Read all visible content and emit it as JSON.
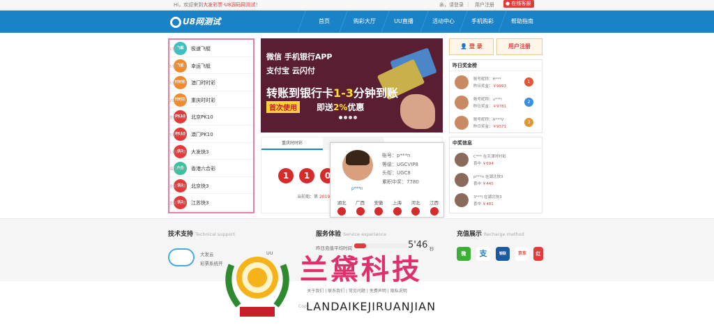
{
  "topbar": {
    "greeting": "Hi，欢迎来到",
    "brand": "大发彩票-U8源码网测试",
    "greeting_end": "！",
    "login": "亲，请登录",
    "sep": "|",
    "register": "用户注册",
    "service": "在线客服"
  },
  "logo": "U8网测试",
  "nav": [
    "首页",
    "购彩大厅",
    "UU直播",
    "活动中心",
    "手机购彩",
    "帮助指南"
  ],
  "lotteries": [
    {
      "name": "极速飞艇",
      "desc": "1分钟",
      "color": "#3cc0c0",
      "icon": "飞艇"
    },
    {
      "name": "幸运飞艇",
      "desc": "5分钟1期",
      "color": "#f08a2a",
      "icon": "飞艇"
    },
    {
      "name": "澳门时时彩",
      "desc": "5分钟一期",
      "color": "#f08a2a",
      "icon": "时时彩"
    },
    {
      "name": "重庆时时彩",
      "desc": "20分一期",
      "color": "#f08a2a",
      "icon": "时时彩"
    },
    {
      "name": "北京PK10",
      "desc": "全天44期",
      "color": "#e23a3a",
      "icon": "PK10"
    },
    {
      "name": "澳门PK10",
      "desc": "5分钟1期",
      "color": "#e23a3a",
      "icon": "PK10"
    },
    {
      "name": "大发快3",
      "desc": "1分钟1期",
      "color": "#e23a3a",
      "icon": "快3"
    },
    {
      "name": "香港六合彩",
      "desc": "每周三期",
      "color": "#3cc0a0",
      "icon": "六合"
    },
    {
      "name": "北京快3",
      "desc": "全天44期",
      "color": "#e23a3a",
      "icon": "快3"
    },
    {
      "name": "江苏快3",
      "desc": "全天41期",
      "color": "#e23a3a",
      "icon": "快3"
    }
  ],
  "banner": {
    "line1": "微信  手机银行APP",
    "line2": "支付宝  云闪付",
    "line3a": "转账到银行卡",
    "line3b": "1-3",
    "line3c": "分钟到账",
    "badge": "首次使用",
    "line4a": "即送",
    "line4b": "2%",
    "line4c": "优惠"
  },
  "draw": {
    "tab": "重庆时时彩",
    "balls": [
      "1",
      "1",
      "0"
    ],
    "period_label": "当前期：第",
    "period": "2019"
  },
  "popup": {
    "account": "账号：p***n",
    "level": "等级：UGCVIP8",
    "title": "头衔：UGC8",
    "total": "累积中奖：7780",
    "name": "p***n",
    "provinces": [
      "湖北",
      "广西",
      "安徽",
      "上海",
      "河北",
      "江西"
    ]
  },
  "auth": {
    "login": "登 录",
    "register": "用户注册"
  },
  "yesterday": {
    "title": "昨日奖金榜",
    "rows": [
      {
        "nick": "账号昵称：H***",
        "prize_label": "昨日奖金：",
        "prize": "￥9993",
        "rank": "1",
        "rank_color": "#e2553a"
      },
      {
        "nick": "账号昵称：u***l",
        "prize_label": "昨日奖金：",
        "prize": "￥9781",
        "rank": "2",
        "rank_color": "#3a8ee0"
      },
      {
        "nick": "账号昵称：A***V",
        "prize_label": "昨日奖金：",
        "prize": "￥9371",
        "rank": "3",
        "rank_color": "#e0953a"
      }
    ]
  },
  "winners": {
    "title": "中奖信息",
    "rows": [
      {
        "line1": "C***  在天津时时彩",
        "label": "喜中",
        "amount": "￥694"
      },
      {
        "line1": "p***n  在湖北快3",
        "label": "喜中",
        "amount": "￥445"
      },
      {
        "line1": "3***l  在湖北快3",
        "label": "喜中",
        "amount": "￥481"
      }
    ]
  },
  "footer": {
    "tech": {
      "title": "技术支持",
      "en": "Technical support",
      "name": "大发云",
      "sub": "彩票系统开",
      "uu": "UU"
    },
    "service": {
      "title": "服务体验",
      "en": "Service experience",
      "avg": "昨日充值平均时间",
      "time": "5'46",
      "unit": "秒",
      "fill": 0.22
    },
    "recharge": {
      "title": "充值展示",
      "en": "Recharge method",
      "methods": [
        "微",
        "支",
        "银联",
        "京东",
        "红"
      ]
    }
  },
  "links": [
    "关于我们",
    "联系我们",
    "常见问题",
    "免费声明",
    "隐私说明"
  ],
  "copyright": "Copy",
  "watermark": {
    "cn": "兰黛科技",
    "en": "LANDAIKEJIRUANJIAN"
  }
}
